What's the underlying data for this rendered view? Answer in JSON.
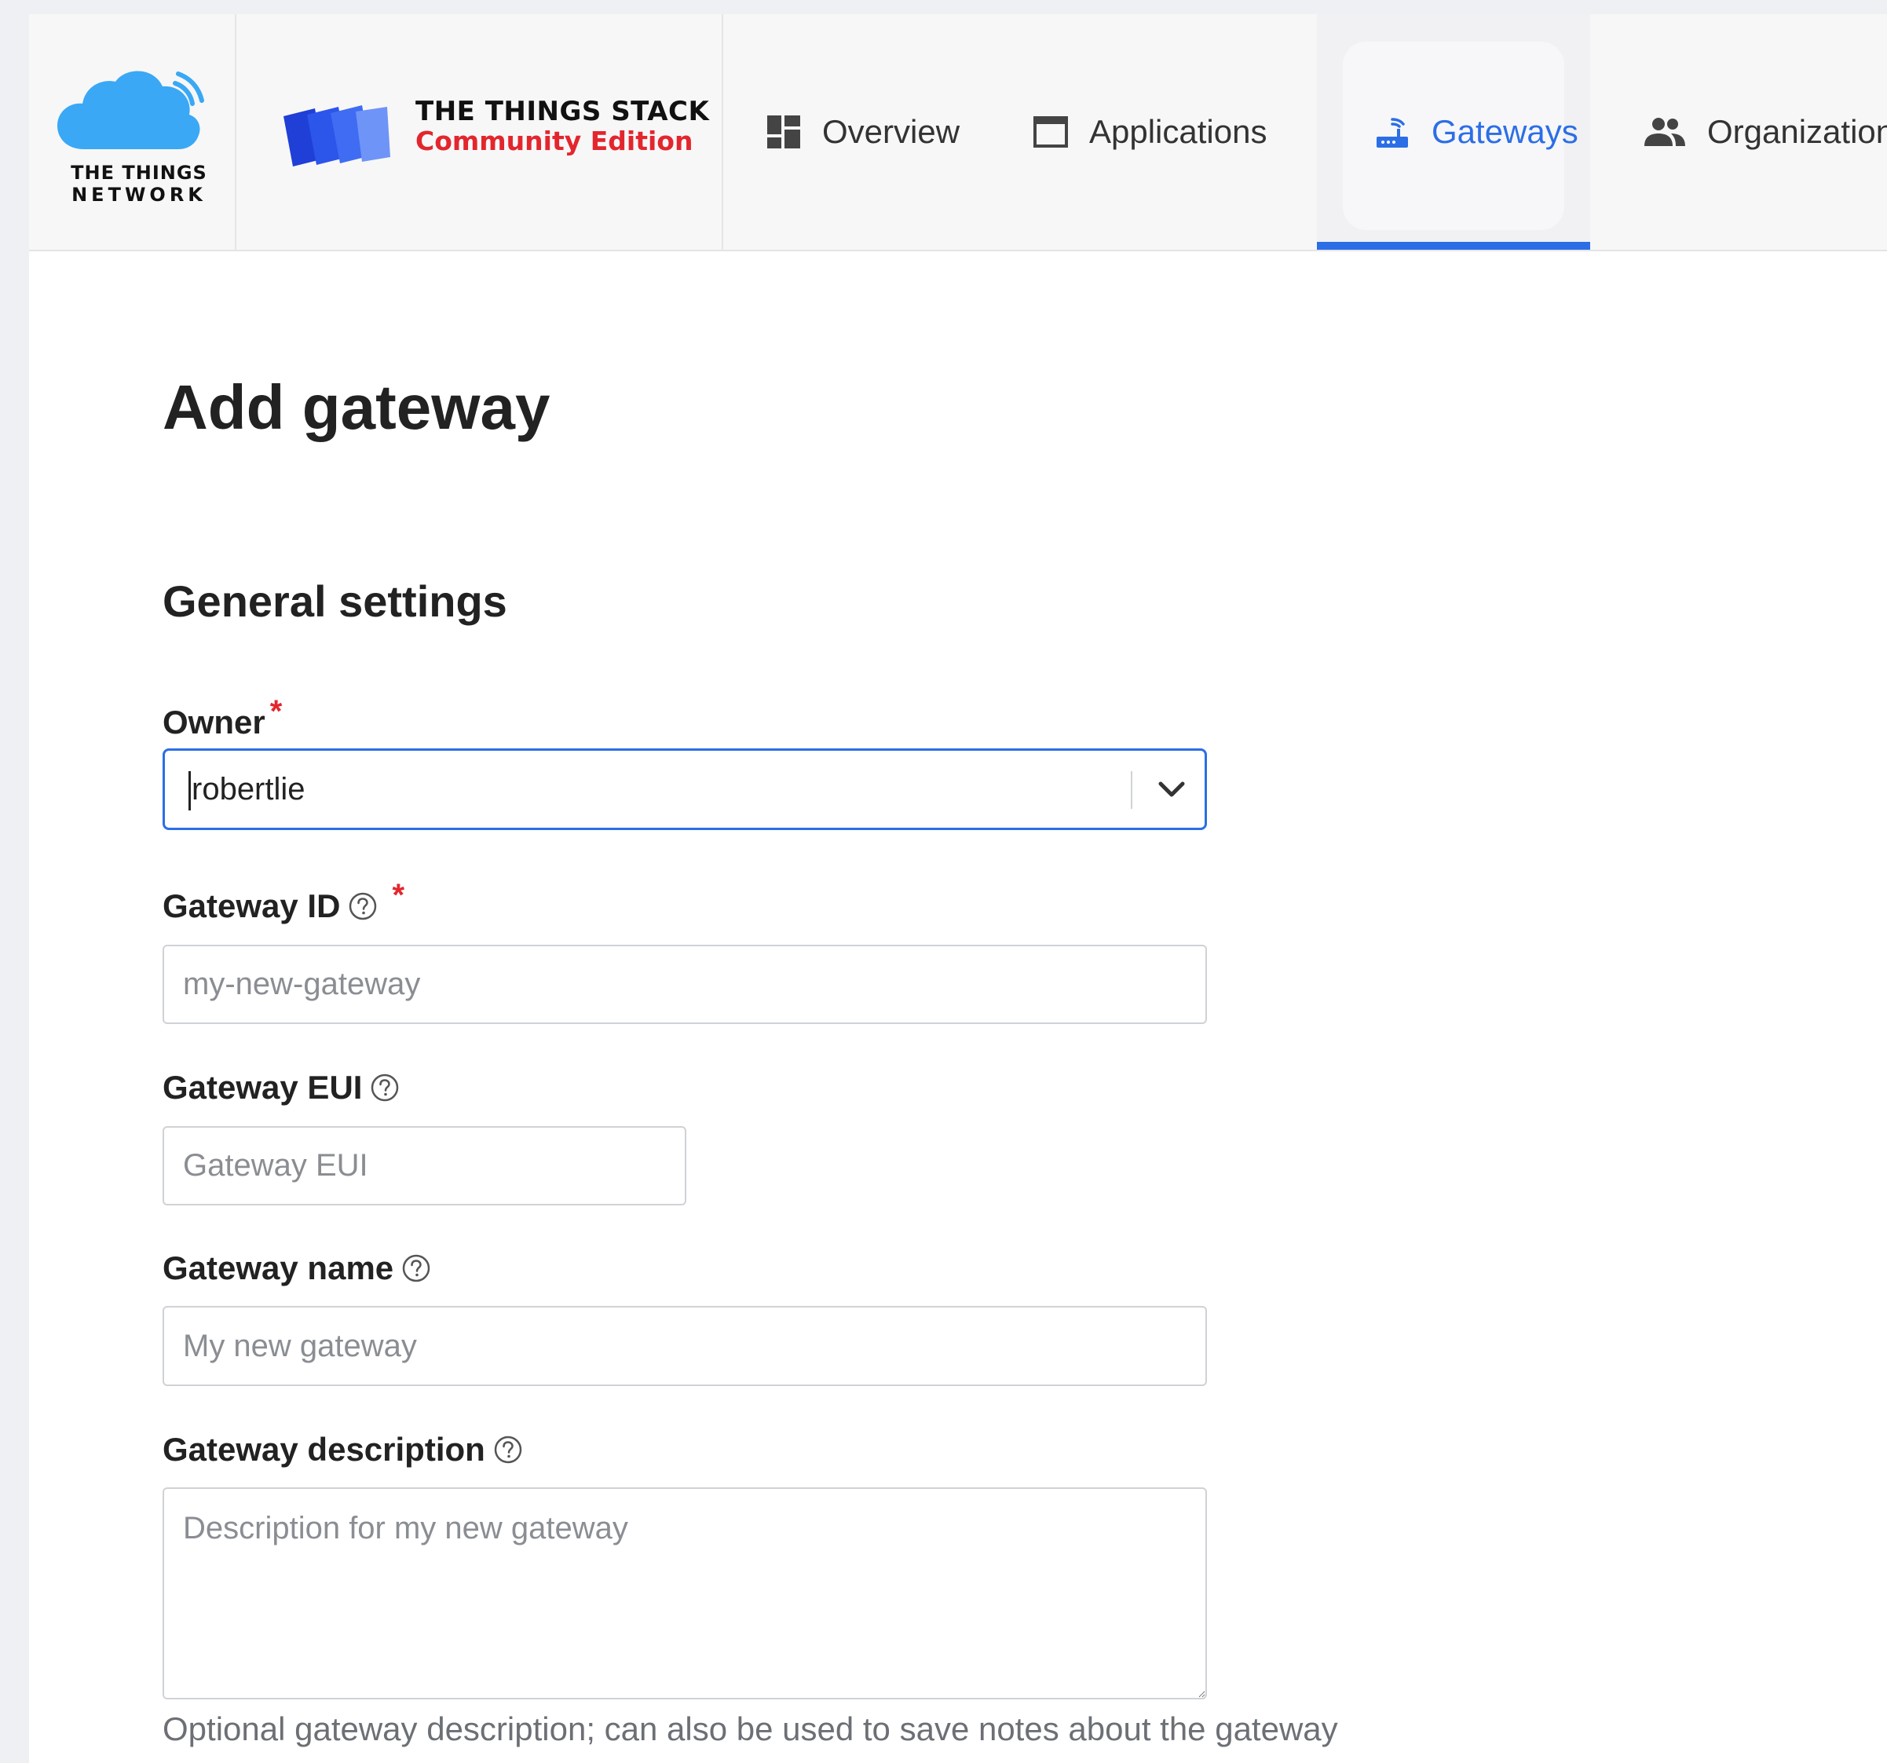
{
  "header": {
    "brand": {
      "ttn_line1": "THE THINGS",
      "ttn_line2": "NETWORK",
      "stack_title": "THE THINGS STACK",
      "stack_subtitle": "Community Edition"
    },
    "nav": [
      {
        "label": "Overview",
        "icon": "dashboard-icon",
        "active": false
      },
      {
        "label": "Applications",
        "icon": "window-icon",
        "active": false
      },
      {
        "label": "Gateways",
        "icon": "gateway-router-icon",
        "active": true
      },
      {
        "label": "Organizations",
        "icon": "people-icon",
        "active": false
      }
    ],
    "active_color": "#2c6ee6"
  },
  "page": {
    "title": "Add gateway",
    "section_title": "General settings"
  },
  "form": {
    "owner": {
      "label": "Owner",
      "value": "robertlie",
      "required": true
    },
    "gateway_id": {
      "label": "Gateway ID",
      "placeholder": "my-new-gateway",
      "required": true
    },
    "gateway_eui": {
      "label": "Gateway EUI",
      "placeholder": "Gateway EUI"
    },
    "gateway_name": {
      "label": "Gateway name",
      "placeholder": "My new gateway"
    },
    "gateway_description": {
      "label": "Gateway description",
      "placeholder": "Description for my new gateway",
      "hint": "Optional gateway description; can also be used to save notes about the gateway"
    },
    "required_marker": "*"
  },
  "colors": {
    "accent": "#2c6ee6",
    "required": "#e3262d",
    "brand_red": "#e3262d",
    "cloud": "#3aa8f5"
  }
}
